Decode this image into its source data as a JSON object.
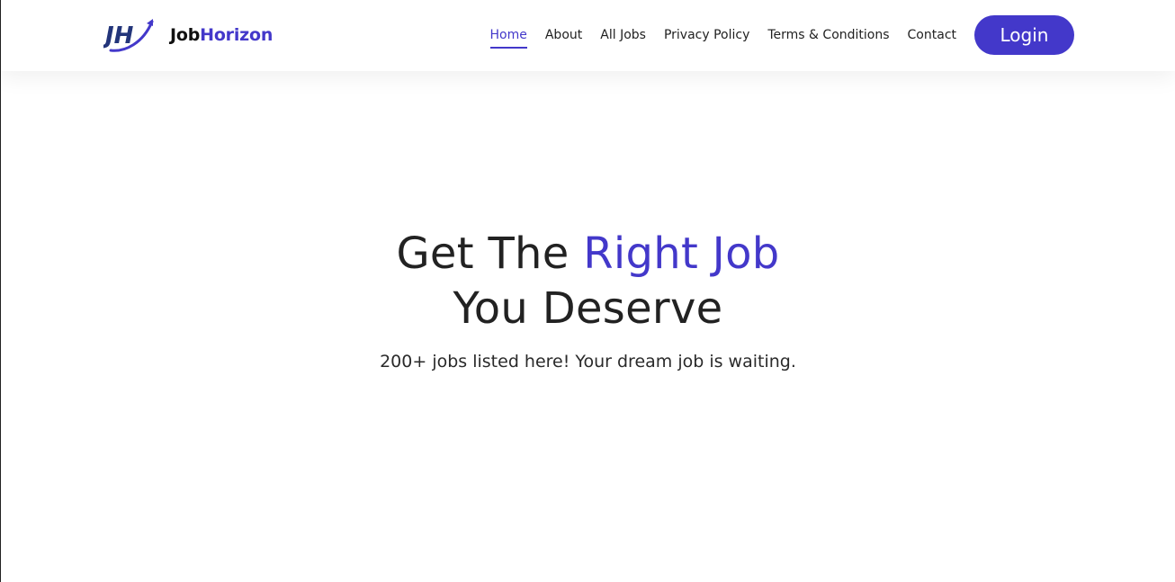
{
  "brand": {
    "logo_icon": "jh-monogram-swoosh",
    "name_part1": "Job",
    "name_part2": "Horizon"
  },
  "nav": {
    "items": [
      {
        "label": "Home",
        "active": true
      },
      {
        "label": "About",
        "active": false
      },
      {
        "label": "All Jobs",
        "active": false
      },
      {
        "label": "Privacy Policy",
        "active": false
      },
      {
        "label": "Terms & Conditions",
        "active": false
      },
      {
        "label": "Contact",
        "active": false
      }
    ],
    "login_label": "Login"
  },
  "hero": {
    "title_part1": "Get The ",
    "title_highlight": "Right Job",
    "title_line2": "You Deserve",
    "subtitle": "200+ jobs listed here! Your dream job is waiting."
  },
  "colors": {
    "accent": "#4338ca",
    "text": "#222222",
    "background": "#ffffff"
  }
}
